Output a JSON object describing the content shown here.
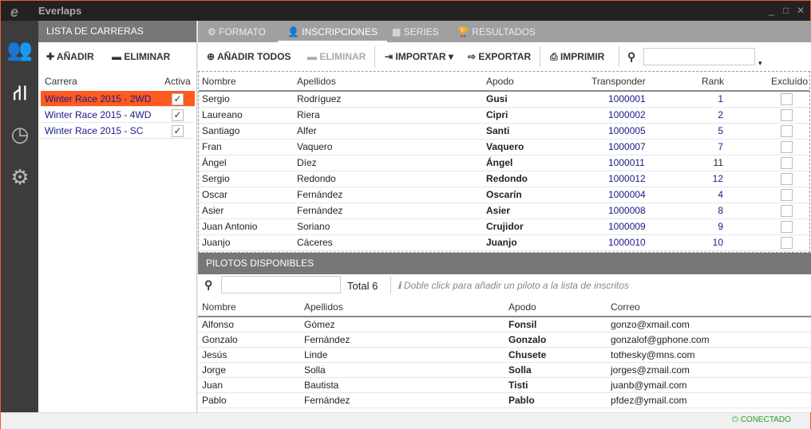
{
  "app": {
    "title": "Everlaps",
    "logo": "e",
    "window_controls": [
      "_",
      "□",
      "✕"
    ]
  },
  "sidebar_icons": [
    "users-icon",
    "road-icon",
    "clock-icon",
    "gears-icon"
  ],
  "races_panel": {
    "title": "LISTA DE CARRERAS",
    "add": "AÑADIR",
    "remove": "ELIMINAR",
    "col_race": "Carrera",
    "col_active": "Activa",
    "races": [
      {
        "name": "Winter Race 2015 - 2WD",
        "active": true,
        "selected": true
      },
      {
        "name": "Winter Race 2015 - 4WD",
        "active": true
      },
      {
        "name": "Winter Race 2015 - SC",
        "active": true
      }
    ]
  },
  "tabs": [
    {
      "label": "FORMATO"
    },
    {
      "label": "INSCRIPCIONES",
      "active": true
    },
    {
      "label": "SERIES"
    },
    {
      "label": "RESULTADOS"
    }
  ],
  "toolbar": {
    "add_all": "AÑADIR TODOS",
    "remove": "ELIMINAR",
    "import": "IMPORTAR",
    "export": "EXPORTAR",
    "print": "IMPRIMIR",
    "search_value": ""
  },
  "entries": {
    "columns": [
      "Nombre",
      "Apellidos",
      "Apodo",
      "Transponder",
      "Rank",
      "Excluído"
    ],
    "rows": [
      [
        "Sergio",
        "Rodríguez",
        "Gusi",
        "1000001",
        "1"
      ],
      [
        "Laureano",
        "Riera",
        "Cipri",
        "1000002",
        "2"
      ],
      [
        "Santiago",
        "Alfer",
        "Santi",
        "1000005",
        "5"
      ],
      [
        "Fran",
        "Vaquero",
        "Vaquero",
        "1000007",
        "7"
      ],
      [
        "Ángel",
        "Díez",
        "Ángel",
        "1000011",
        "11"
      ],
      [
        "Sergio",
        "Redondo",
        "Redondo",
        "1000012",
        "12"
      ],
      [
        "Oscar",
        "Fernández",
        "Oscarín",
        "1000004",
        "4"
      ],
      [
        "Asier",
        "Fernández",
        "Asier",
        "1000008",
        "8"
      ],
      [
        "Juan Antonio",
        "Soriano",
        "Crujidor",
        "1000009",
        "9"
      ],
      [
        "Juanjo",
        "Cáceres",
        "Juanjo",
        "1000010",
        "10"
      ]
    ]
  },
  "pilots": {
    "title": "PILOTOS DISPONIBLES",
    "total": "Total 6",
    "hint": "Doble click para añadir un piloto a la lista de inscritos",
    "search_value": "",
    "columns": [
      "Nombre",
      "Apellidos",
      "Apodo",
      "Correo"
    ],
    "rows": [
      [
        "Alfonso",
        "Gómez",
        "Fonsil",
        "gonzo@xmail.com"
      ],
      [
        "Gonzalo",
        "Fernández",
        "Gonzalo",
        "gonzalof@gphone.com"
      ],
      [
        "Jesús",
        "Linde",
        "Chusete",
        "tothesky@mns.com"
      ],
      [
        "Jorge",
        "Solla",
        "Solla",
        "jorges@zmail.com"
      ],
      [
        "Juan",
        "Bautista",
        "Tisti",
        "juanb@ymail.com"
      ],
      [
        "Pablo",
        "Fernández",
        "Pablo",
        "pfdez@ymail.com"
      ]
    ]
  },
  "status": {
    "text": "CONECTADO",
    "color": "#2a9d2a"
  },
  "accent": "#ff5a1f"
}
